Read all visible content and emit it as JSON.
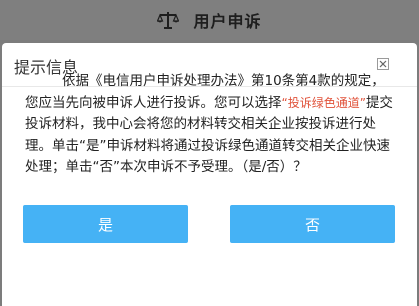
{
  "background": {
    "title": "用户申诉",
    "icon": "scale-icon"
  },
  "dialog": {
    "title": "提示信息",
    "close_icon": "close-icon",
    "message_part1": "依据《电信用户申诉处理办法》第10条第4款的规定，您应当先向被申诉人进行投诉。您可以选择",
    "link_text": "“投诉绿色通道”",
    "message_part2": "提交投诉材料，我中心会将您的材料转交相关企业按投诉进行处理。单击“是”申诉材料将通过投诉绿色通道转交相关企业快速处理；单击“否”本次申诉不予受理。（是/否）？",
    "yes_label": "是",
    "no_label": "否"
  },
  "colors": {
    "overlay": "#7c7c7c",
    "button": "#45b2f5",
    "link": "#e0523a"
  }
}
